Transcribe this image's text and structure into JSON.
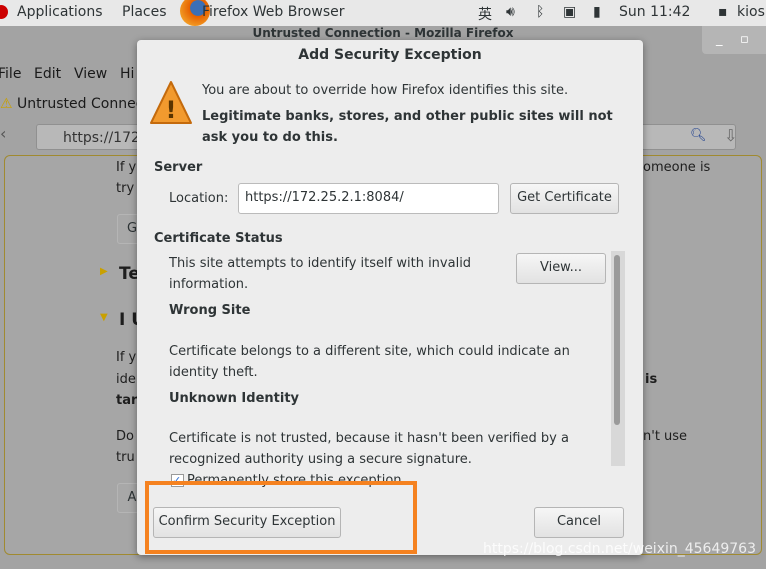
{
  "topbar": {
    "applications": "Applications",
    "places": "Places",
    "app_name": "Firefox Web Browser",
    "ime": "英",
    "clock": "Sun 11:42",
    "user": "kios"
  },
  "browser": {
    "window_title": "Untrusted Connection - Mozilla Firefox",
    "menu": [
      "File",
      "Edit",
      "View",
      "Hi"
    ],
    "tab": "Untrusted Connec",
    "url": "https://172",
    "bg_lines": [
      "If y",
      "try",
      "omeone is",
      "Te",
      "I U",
      "If y",
      "ide",
      "tar",
      "is",
      "Do",
      "tru",
      "n't use"
    ],
    "bg_buttons": [
      "G",
      "A"
    ]
  },
  "dialog": {
    "title": "Add Security Exception",
    "intro": "You are about to override how Firefox identifies this site.",
    "warning": "Legitimate banks, stores, and other public sites will not ask you to do this.",
    "server_heading": "Server",
    "location_label": "Location:",
    "location_value": "https://172.25.2.1:8084/",
    "get_certificate": "Get Certificate",
    "status_heading": "Certificate Status",
    "status_text": "This site attempts to identify itself with invalid information.",
    "view_button": "View...",
    "wrong_site_heading": "Wrong Site",
    "wrong_site_text": "Certificate belongs to a different site, which could indicate an identity theft.",
    "unknown_heading": "Unknown Identity",
    "unknown_text": "Certificate is not trusted, because it hasn't been verified by a recognized authority using a secure signature.",
    "permanent_label": "Permanently store this exception",
    "permanent_checked": true,
    "confirm": "Confirm Security Exception",
    "cancel": "Cancel"
  },
  "highlight_color": "#f58220",
  "watermark": "https://blog.csdn.net/weixin_45649763"
}
